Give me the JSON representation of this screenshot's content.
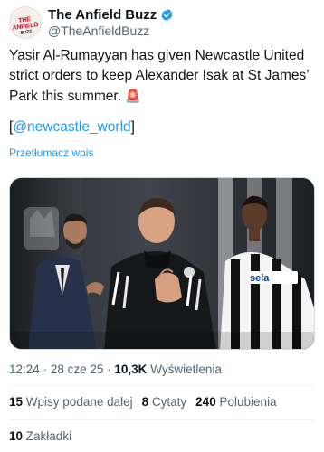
{
  "author": {
    "display_name": "The Anfield Buzz",
    "handle": "@TheAnfieldBuzz",
    "avatar_text_line1": "THE ANFIELD",
    "avatar_text_line2": "BUZZ",
    "verified_icon": "verified-badge-icon",
    "verified_color": "#1d9bf0"
  },
  "post": {
    "text": "Yasir Al-Rumayyan has given Newcastle United strict orders to keep Alexander Isak at St James’ Park this summer.",
    "emoji": "🚨",
    "mention_open": "[",
    "mention": "@newcastle_world",
    "mention_close": "]",
    "translate_label": "Przetłumacz wpis",
    "media_shirt_sponsor": "sela"
  },
  "meta": {
    "time": "12:24",
    "separator": "·",
    "date": "28 cze 25",
    "views_count": "10,3K",
    "views_label": "Wyświetlenia"
  },
  "stats": {
    "reposts_count": "15",
    "reposts_label": "Wpisy podane dalej",
    "quotes_count": "8",
    "quotes_label": "Cytaty",
    "likes_count": "240",
    "likes_label": "Polubienia",
    "bookmarks_count": "10",
    "bookmarks_label": "Zakładki"
  },
  "colors": {
    "link": "#1d9bf0",
    "text": "#0f1419",
    "secondary": "#536471",
    "divider": "#eff3f4"
  }
}
